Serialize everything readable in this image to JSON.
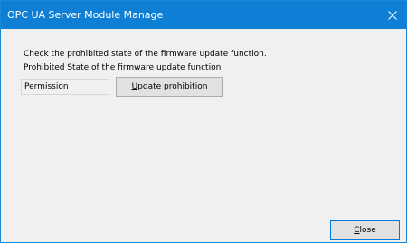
{
  "window": {
    "title": "OPC UA Server Module Manage"
  },
  "content": {
    "description": "Check the prohibited state of the firmware update function.",
    "state_label": "Prohibited State of the firmware update function",
    "state_value": "Permission"
  },
  "buttons": {
    "update_prohibition": {
      "mnemonic": "U",
      "rest": "pdate prohibition"
    },
    "close": {
      "mnemonic": "C",
      "rest": "lose"
    }
  },
  "colors": {
    "titlebar": "#0f7fd6",
    "client_background": "#f0f0f0",
    "button_face": "#e1e1e1",
    "focus_border": "#0078d7"
  },
  "icons": {
    "close": "close-icon"
  }
}
